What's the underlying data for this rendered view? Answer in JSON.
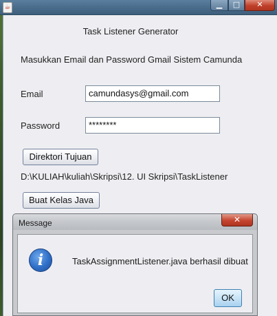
{
  "main_window": {
    "title": "",
    "controls": {
      "minimize": "▁",
      "maximize": "□",
      "close": "✕"
    },
    "icon": "java-cup-icon"
  },
  "form": {
    "app_title": "Task Listener Generator",
    "instruction": "Masukkan Email dan Password Gmail Sistem Camunda",
    "email_label": "Email",
    "email_value": "camundasys@gmail.com",
    "password_label": "Password",
    "password_value": "********",
    "directory_button": "Direktori Tujuan",
    "directory_path": "D:\\KULIAH\\kuliah\\Skripsi\\12. UI Skripsi\\TaskListener",
    "create_button": "Buat Kelas Java"
  },
  "dialog": {
    "title": "Message",
    "close": "✕",
    "icon": "info-icon",
    "message": "TaskAssignmentListener.java berhasil dibuat",
    "ok_button": "OK"
  }
}
